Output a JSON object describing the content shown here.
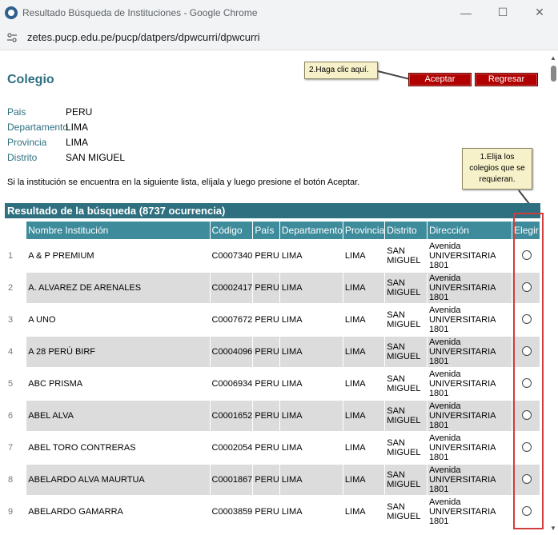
{
  "window": {
    "title": "Resultado Búsqueda de Instituciones - Google Chrome",
    "minimize": "—",
    "maximize": "☐",
    "close": "✕"
  },
  "address": {
    "url": "zetes.pucp.edu.pe/pucp/datpers/dpwcurri/dpwcurri"
  },
  "page": {
    "title": "Colegio",
    "tooltip_aceptar": "2.Haga clic aquí.",
    "tooltip_elegir": [
      "1.Elija los",
      "colegios que se",
      "requieran."
    ],
    "btn_aceptar": "Aceptar",
    "btn_regresar": "Regresar",
    "info": [
      {
        "label": "Pais",
        "value": "PERU"
      },
      {
        "label": "Departamento",
        "value": "LIMA"
      },
      {
        "label": "Provincia",
        "value": "LIMA"
      },
      {
        "label": "Distrito",
        "value": "SAN MIGUEL"
      }
    ],
    "instructions": "Si la institución se encuentra en la siguiente lista, elíjala y luego presione el botón Aceptar.",
    "result_header": "Resultado de la búsqueda (8737 ocurrencia)",
    "columns": [
      "Nombre Institución",
      "Código",
      "País",
      "Departamento",
      "Provincia",
      "Distrito",
      "Dirección",
      "Elegir"
    ],
    "rows": [
      {
        "n": "1",
        "nombre": "A & P PREMIUM",
        "codigo": "C0007340",
        "pais": "PERU",
        "dep": "LIMA",
        "prov": "LIMA",
        "dist": [
          "SAN",
          "MIGUEL"
        ],
        "dir": [
          "Avenida",
          "UNIVERSITARIA",
          "1801"
        ]
      },
      {
        "n": "2",
        "nombre": "A. ALVAREZ DE ARENALES",
        "codigo": "C0002417",
        "pais": "PERU",
        "dep": "LIMA",
        "prov": "LIMA",
        "dist": [
          "SAN",
          "MIGUEL"
        ],
        "dir": [
          "Avenida",
          "UNIVERSITARIA",
          "1801"
        ]
      },
      {
        "n": "3",
        "nombre": "A UNO",
        "codigo": "C0007672",
        "pais": "PERU",
        "dep": "LIMA",
        "prov": "LIMA",
        "dist": [
          "SAN",
          "MIGUEL"
        ],
        "dir": [
          "Avenida",
          "UNIVERSITARIA",
          "1801"
        ]
      },
      {
        "n": "4",
        "nombre": "A 28 PERÚ BIRF",
        "codigo": "C0004096",
        "pais": "PERU",
        "dep": "LIMA",
        "prov": "LIMA",
        "dist": [
          "SAN",
          "MIGUEL"
        ],
        "dir": [
          "Avenida",
          "UNIVERSITARIA",
          "1801"
        ]
      },
      {
        "n": "5",
        "nombre": "ABC PRISMA",
        "codigo": "C0006934",
        "pais": "PERU",
        "dep": "LIMA",
        "prov": "LIMA",
        "dist": [
          "SAN",
          "MIGUEL"
        ],
        "dir": [
          "Avenida",
          "UNIVERSITARIA",
          "1801"
        ]
      },
      {
        "n": "6",
        "nombre": "ABEL ALVA",
        "codigo": "C0001652",
        "pais": "PERU",
        "dep": "LIMA",
        "prov": "LIMA",
        "dist": [
          "SAN",
          "MIGUEL"
        ],
        "dir": [
          "Avenida",
          "UNIVERSITARIA",
          "1801"
        ]
      },
      {
        "n": "7",
        "nombre": "ABEL TORO CONTRERAS",
        "codigo": "C0002054",
        "pais": "PERU",
        "dep": "LIMA",
        "prov": "LIMA",
        "dist": [
          "SAN",
          "MIGUEL"
        ],
        "dir": [
          "Avenida",
          "UNIVERSITARIA",
          "1801"
        ]
      },
      {
        "n": "8",
        "nombre": "ABELARDO ALVA MAURTUA",
        "codigo": "C0001867",
        "pais": "PERU",
        "dep": "LIMA",
        "prov": "LIMA",
        "dist": [
          "SAN",
          "MIGUEL"
        ],
        "dir": [
          "Avenida",
          "UNIVERSITARIA",
          "1801"
        ]
      },
      {
        "n": "9",
        "nombre": "ABELARDO GAMARRA",
        "codigo": "C0003859",
        "pais": "PERU",
        "dep": "LIMA",
        "prov": "LIMA",
        "dist": [
          "SAN",
          "MIGUEL"
        ],
        "dir": [
          "Avenida",
          "UNIVERSITARIA",
          "1801"
        ]
      }
    ]
  },
  "colors": {
    "accent": "#2e7080",
    "header": "#3e8b9c",
    "button": "#b00000",
    "highlight": "#d23c3c",
    "tooltip": "#f6f1c9"
  },
  "icons": {
    "app": "chrome-app-icon",
    "site": "site-settings-icon"
  }
}
